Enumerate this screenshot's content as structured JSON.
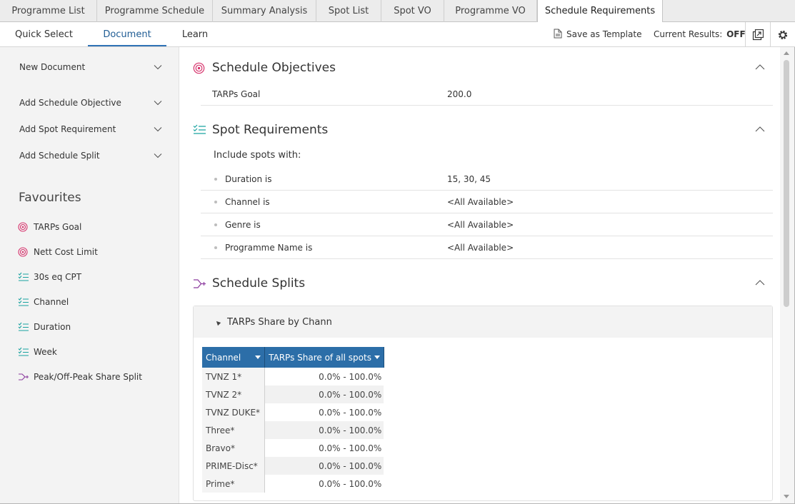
{
  "tabs": [
    "Programme List",
    "Programme Schedule",
    "Summary Analysis",
    "Spot List",
    "Spot VO",
    "Programme VO",
    "Schedule Requirements"
  ],
  "ribbon": {
    "tabs": [
      "Quick Select",
      "Document",
      "Learn"
    ],
    "save_template": "Save as Template",
    "current_results_label": "Current Results:",
    "current_results_value": "OFF"
  },
  "sidebar": {
    "menus": [
      "New Document",
      "Add Schedule Objective",
      "Add Spot Requirement",
      "Add Schedule Split"
    ],
    "favourites_title": "Favourites",
    "favourites": [
      {
        "label": "TARPs Goal",
        "icon": "target-icon"
      },
      {
        "label": "Nett Cost Limit",
        "icon": "target-icon"
      },
      {
        "label": "30s eq CPT",
        "icon": "checklist-icon"
      },
      {
        "label": "Channel",
        "icon": "checklist-icon"
      },
      {
        "label": "Duration",
        "icon": "checklist-icon"
      },
      {
        "label": "Week",
        "icon": "checklist-icon"
      },
      {
        "label": "Peak/Off-Peak Share Split",
        "icon": "split-icon"
      }
    ]
  },
  "main": {
    "objectives": {
      "title": "Schedule Objectives",
      "rows": [
        {
          "key": "TARPs Goal",
          "value": "200.0"
        }
      ]
    },
    "spot_requirements": {
      "title": "Spot Requirements",
      "include_text": "Include spots with:",
      "rows": [
        {
          "key": "Duration is",
          "value": "15, 30, 45"
        },
        {
          "key": "Channel is",
          "value": "<All Available>"
        },
        {
          "key": "Genre is",
          "value": "<All Available>"
        },
        {
          "key": "Programme Name is",
          "value": "<All Available>"
        }
      ]
    },
    "splits": {
      "title": "Schedule Splits",
      "split_name": "TARPs Share by Chann",
      "columns": [
        "Channel",
        "TARPs Share of all spots"
      ],
      "rows": [
        {
          "channel": "TVNZ 1*",
          "share": "0.0% - 100.0%"
        },
        {
          "channel": "TVNZ 2*",
          "share": "0.0% - 100.0%"
        },
        {
          "channel": "TVNZ DUKE*",
          "share": "0.0% - 100.0%"
        },
        {
          "channel": "Three*",
          "share": "0.0% - 100.0%"
        },
        {
          "channel": "Bravo*",
          "share": "0.0% - 100.0%"
        },
        {
          "channel": "PRIME-Disc*",
          "share": "0.0% - 100.0%"
        },
        {
          "channel": "Prime*",
          "share": "0.0% - 100.0%"
        }
      ]
    }
  },
  "colors": {
    "accent_blue": "#2c6ea8",
    "objective_pink": "#d6336c",
    "requirement_teal": "#1aa3a0",
    "split_purple": "#8b3a9e"
  }
}
